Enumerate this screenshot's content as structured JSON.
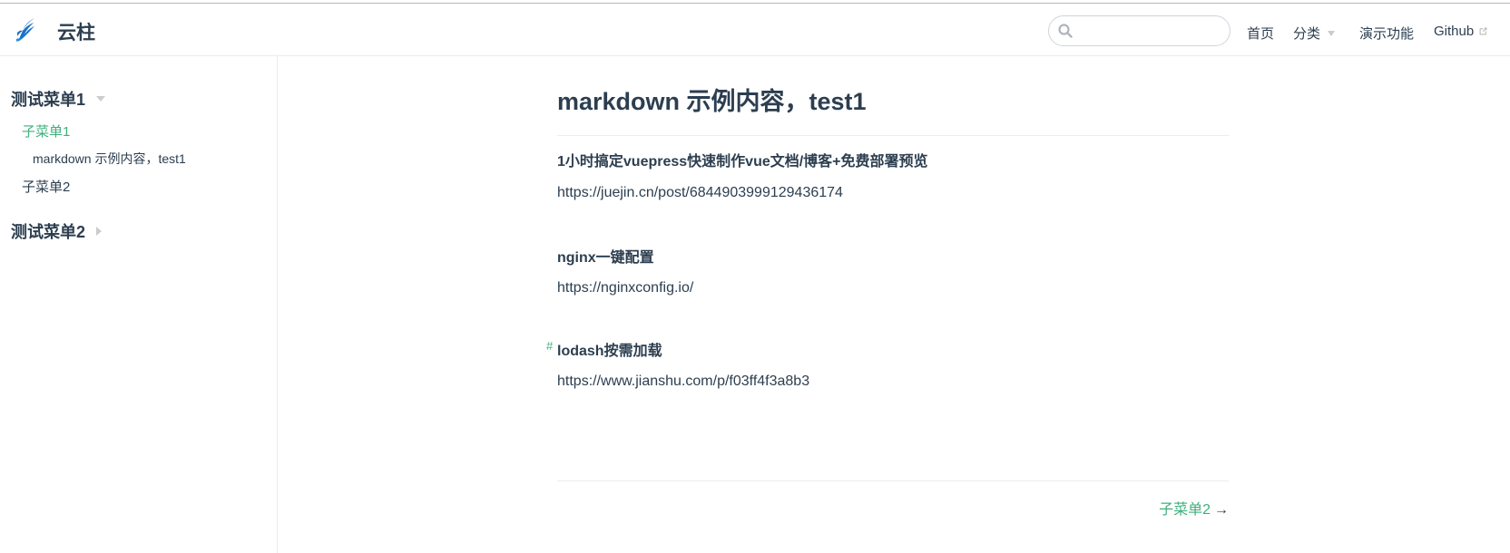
{
  "header": {
    "site_name": "云柱",
    "search": {
      "value": "",
      "placeholder": ""
    },
    "nav": {
      "home": "首页",
      "category": "分类",
      "demo": "演示功能",
      "github": "Github"
    }
  },
  "sidebar": {
    "groups": [
      {
        "title": "测试菜单1",
        "expanded": true,
        "items": [
          {
            "label": "子菜单1",
            "active": true,
            "children": [
              "markdown 示例内容，test1"
            ]
          },
          {
            "label": "子菜单2",
            "active": false
          }
        ]
      },
      {
        "title": "测试菜单2",
        "expanded": false
      }
    ]
  },
  "main": {
    "title": "markdown 示例内容，test1",
    "sections": [
      {
        "heading": "1小时搞定vuepress快速制作vue文档/博客+免费部署预览",
        "text": "https://juejin.cn/post/6844903999129436174"
      },
      {
        "heading": "nginx一键配置",
        "text": "https://nginxconfig.io/"
      },
      {
        "heading": "lodash按需加载",
        "text": "https://www.jianshu.com/p/f03ff4f3a8b3",
        "anchor": "#"
      }
    ],
    "next_page": {
      "label": "子菜单2",
      "arrow": "→"
    }
  },
  "colors": {
    "accent": "#3eaf7c",
    "text": "#2c3e50",
    "border": "#eaecef"
  }
}
